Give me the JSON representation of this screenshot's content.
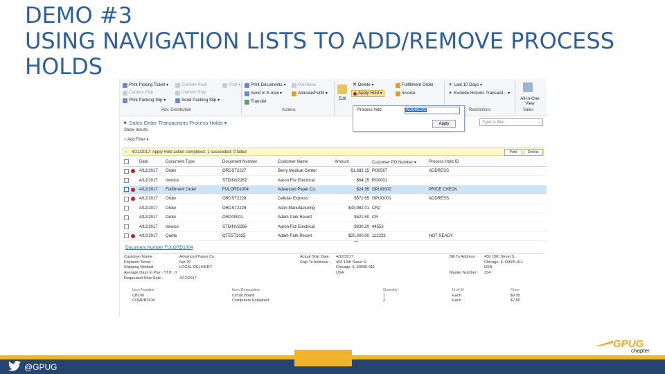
{
  "slide": {
    "title_lines": [
      "DEMO #3",
      "USING NAVIGATION LISTS TO ADD/REMOVE PROCESS",
      "HOLDS"
    ],
    "footer_handle": "@GPUG",
    "logo_text_gp": "GP",
    "logo_text_ug": "UG",
    "logo_chapter": "chapter"
  },
  "ribbon": {
    "print_picking_ticket": "Print Picking Ticket ▾",
    "confirm_pick": "Confirm Pick",
    "print_packing_slip": "Print Packing Slip ▾",
    "confirm_pack": "Confirm Pack",
    "confirm_ship": "Confirm Ship",
    "send_packing_slip": "Send Packing Slip ▾",
    "post": "Post ▾",
    "group_adv_distribution": "Adv. Distribution",
    "print_documents": "Print Documents ▾",
    "send_in_email": "Send in E-mail ▾",
    "transfer": "Transfer",
    "purchase": "Purchase",
    "allocate_fulfill": "Allocate/Fulfill ▾",
    "group_actions": "Actions",
    "edit": "Edit",
    "delete": "Delete ▾",
    "apply_hold": "Apply Hold ▾",
    "fulfillment_order": "Fulfillment Order",
    "invoice": "Invoice",
    "last_10_days": "Last 10 Days ▾",
    "exclude_historic": "Exclude Historic Transacti... ▾",
    "group_restrictions": "Restrictions",
    "all_in_one_view": "All-in-One View",
    "group_sales": "Sales"
  },
  "popup": {
    "label": "Process hold",
    "selected": "ADDRESS",
    "apply": "Apply"
  },
  "list": {
    "title": "Sales Order Transactions Process Holds ▾",
    "show_results": "Show results",
    "add_filter": "Add Filter ▾",
    "filter_placeholder": "Type to filter",
    "notice": "4/21/2017: Apply Hold action completed: 1 succeeded; 0 failed",
    "print": "Print",
    "delete": "Delete",
    "columns": [
      "Date",
      "Document Type",
      "Document Number",
      "Customer Name",
      "Amount",
      "Customer PO Number",
      "Process Hold ID"
    ],
    "rows": [
      {
        "hold": true,
        "date": "4/12/2017",
        "type": "Order",
        "number": "ORDST2227",
        "customer": "Berry Medical Center",
        "amount": "$1,683.15",
        "po": "PO0567",
        "hold_id": "ADDRESS"
      },
      {
        "hold": false,
        "date": "4/12/2017",
        "type": "Invoice",
        "number": "STDINV2267",
        "customer": "Aaron Fitz Electrical",
        "amount": "$64.15",
        "po": "PO0001",
        "hold_id": ""
      },
      {
        "hold": true,
        "date": "4/12/2017",
        "type": "Fulfillment Order",
        "number": "FULORD1004",
        "customer": "Advanced Paper Co.",
        "amount": "$24.95",
        "po": "GPUG002",
        "hold_id": "PRICE CHECK"
      },
      {
        "hold": true,
        "date": "4/12/2017",
        "type": "Order",
        "number": "ORDST2228",
        "customer": "Cellular Express",
        "amount": "$571.65",
        "po": "GPUG001",
        "hold_id": "ADDRESS"
      },
      {
        "hold": false,
        "date": "4/12/2017",
        "type": "Order",
        "number": "ORDST2229",
        "customer": "Alton Manufacturing",
        "amount": "$43,982.01",
        "po": "CR2",
        "hold_id": ""
      },
      {
        "hold": false,
        "date": "4/12/2017",
        "type": "Order",
        "number": "ORD00001",
        "customer": "Adam Park Resort",
        "amount": "$521.50",
        "po": "CR",
        "hold_id": ""
      },
      {
        "hold": false,
        "date": "4/12/2017",
        "type": "Invoice",
        "number": "STDINV2266",
        "customer": "Aaron Fitz Electrical",
        "amount": "$930.20",
        "po": "44553",
        "hold_id": ""
      },
      {
        "hold": true,
        "date": "4/10/2017",
        "type": "Quote",
        "number": "QTEST1025",
        "customer": "Adam Park Resort",
        "amount": "$20,000.00",
        "po": "112233",
        "hold_id": "NOT READY"
      }
    ]
  },
  "detail": {
    "doc_number": "Document Number FULORD1004",
    "labels_left": [
      "Customer Name :",
      "Payment Terms :",
      "Shipping Method :",
      "Average Days to Pay - YTD : 0",
      "Requested Ship Date :"
    ],
    "values_left": [
      "Advanced Paper Co.",
      "Net 30",
      "LOCAL DELIVERY",
      "",
      "4/12/2017"
    ],
    "labels_mid": [
      "Actual Ship Date :",
      "Ship To Address :"
    ],
    "values_mid": [
      "4/12/2017",
      "456 19th Street S.",
      "Chicago, IL 60605-911",
      "USA"
    ],
    "labels_right": [
      "Bill To Address :",
      "",
      "",
      "Master Number :"
    ],
    "values_right": [
      "456 19th Street S.",
      "Chicago, IL 60605-911",
      "USA",
      "334"
    ],
    "item_headers": [
      "Item Number",
      "Item Description",
      "Quantity",
      "U of M",
      "Price"
    ],
    "items": [
      {
        "number": "CB100",
        "description": "Circuit Board",
        "qty": "1",
        "uom": "Each",
        "price": "$9.95"
      },
      {
        "number": "COMPBOOK",
        "description": "Computers Explained",
        "qty": "2",
        "uom": "Each",
        "price": "$7.50"
      }
    ]
  }
}
